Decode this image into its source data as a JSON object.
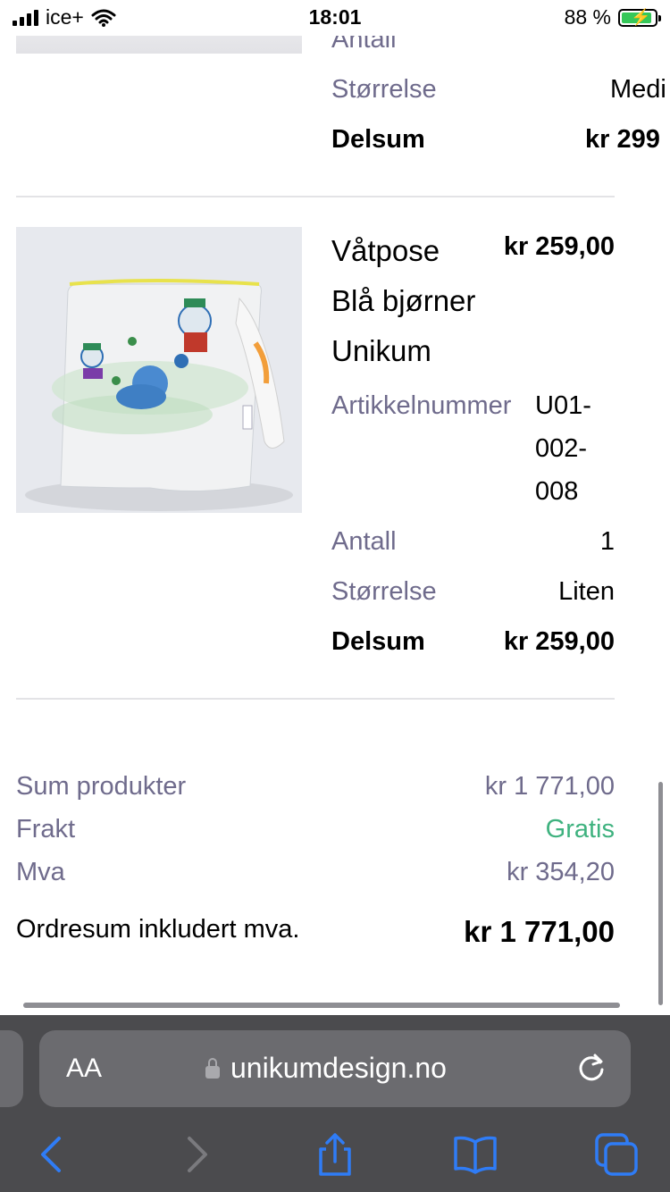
{
  "status": {
    "carrier": "ice+",
    "time": "18:01",
    "battery": "88 %"
  },
  "item_prev": {
    "antall_label": "Antall",
    "size_label": "Størrelse",
    "size_value": "Medi",
    "subtotal_label": "Delsum",
    "subtotal_value": "kr 299"
  },
  "item": {
    "name_line1": "Våtpose",
    "name_line2": "Blå bjørner",
    "name_line3": "Unikum",
    "price": "kr 259,00",
    "sku_label": "Artikkelnummer",
    "sku_line1": "U01-",
    "sku_line2": "002-",
    "sku_line3": "008",
    "qty_label": "Antall",
    "qty_value": "1",
    "size_label": "Størrelse",
    "size_value": "Liten",
    "subtotal_label": "Delsum",
    "subtotal_value": "kr 259,00"
  },
  "summary": {
    "products_label": "Sum produkter",
    "products_value": "kr 1 771,00",
    "shipping_label": "Frakt",
    "shipping_value": "Gratis",
    "vat_label": "Mva",
    "vat_value": "kr 354,20",
    "total_label": "Ordresum inkludert mva.",
    "total_value": "kr 1 771,00"
  },
  "browser": {
    "aa_label": "AA",
    "url": "unikumdesign.no"
  },
  "colors": {
    "accent_blue": "#2f7cf6",
    "label_gray": "#6f6b8c",
    "free_green": "#3fb27f",
    "toolbar_bg": "#4b4b4e"
  }
}
